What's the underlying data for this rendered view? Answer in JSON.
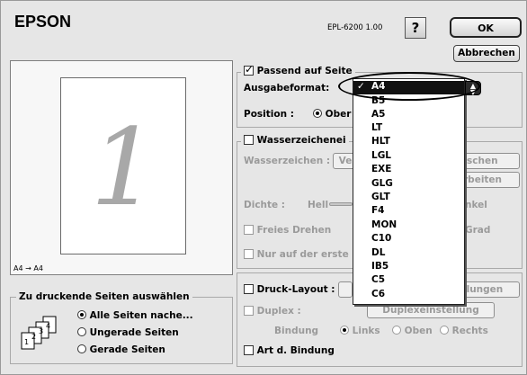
{
  "header": {
    "brand": "EPSON",
    "model": "EPL-6200  1.00",
    "help_label": "?",
    "ok_label": "OK",
    "cancel_label": "Abbrechen"
  },
  "preview": {
    "page_number": "1",
    "paper_mapping": "A4 → A4"
  },
  "fit_to_page": {
    "checkbox_label": "Passend auf Seite",
    "checked": true,
    "output_label": "Ausgabeformat:",
    "position_label": "Position :",
    "position_option": "Ober"
  },
  "output_menu": {
    "selected": "A4",
    "check": "✓",
    "items": [
      "A4",
      "B5",
      "A5",
      "LT",
      "HLT",
      "LGL",
      "EXE",
      "GLG",
      "GLT",
      "F4",
      "MON",
      "C10",
      "DL",
      "IB5",
      "C5",
      "C6"
    ]
  },
  "watermark": {
    "checkbox_label": "Wasserzeichenei",
    "field_label": "Wasserzeichen :",
    "select_value": "Ve",
    "delete_button": "schen",
    "edit_button": "rbeiten",
    "density_label": "Dichte :",
    "light_label": "Hell",
    "dark_label": "nkel",
    "rotate_label": "Freies Drehen",
    "degree_label": "Grad",
    "first_page_label": "Nur auf der erste"
  },
  "layout": {
    "checkbox_label": "Druck-Layout :",
    "settings_button": "llungen",
    "duplex_label": "Duplex :",
    "duplex_button": "Duplexeinstellung",
    "binding_label": "Bindung",
    "binding_options": [
      "Links",
      "Oben",
      "Rechts"
    ],
    "binding_type_label": "Art d. Bindung"
  },
  "pages_group": {
    "title": "Zu druckende Seiten auswählen",
    "options": [
      "Alle Seiten nache...",
      "Ungerade Seiten",
      "Gerade Seiten"
    ],
    "selected_index": 0,
    "icon_numbers": [
      "1",
      "2",
      "3",
      "4"
    ]
  }
}
